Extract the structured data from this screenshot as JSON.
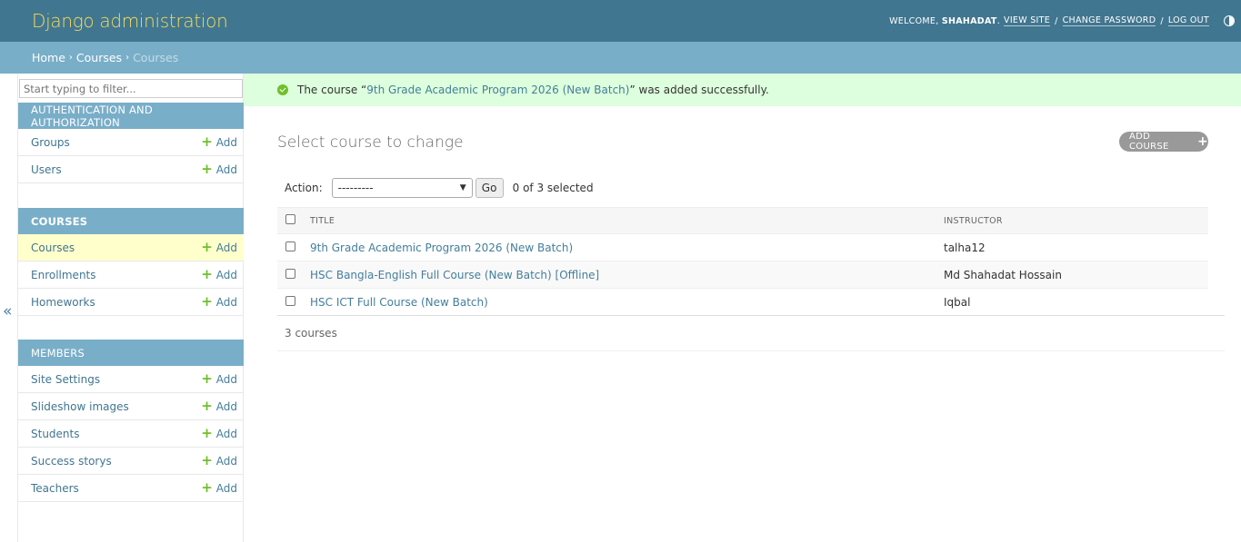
{
  "header": {
    "brand": "Django administration",
    "welcome_prefix": "WELCOME,",
    "username": "SHAHADAT",
    "welcome_suffix": ".",
    "view_site": "VIEW SITE",
    "change_password": "CHANGE PASSWORD",
    "log_out": "LOG OUT",
    "separator": "/",
    "theme_icon": "theme-toggle-icon"
  },
  "breadcrumbs": {
    "home": "Home",
    "app": "Courses",
    "current": "Courses",
    "separator": "›"
  },
  "sidebar": {
    "filter_placeholder": "Start typing to filter...",
    "collapse": "«",
    "add_label": "Add",
    "modules": [
      {
        "caption": "Authentication and Authorization",
        "models": [
          {
            "name": "Groups"
          },
          {
            "name": "Users"
          }
        ]
      },
      {
        "caption": "Courses",
        "models": [
          {
            "name": "Courses"
          },
          {
            "name": "Enrollments"
          },
          {
            "name": "Homeworks"
          }
        ]
      },
      {
        "caption": "Members",
        "models": [
          {
            "name": "Site Settings"
          },
          {
            "name": "Slideshow images"
          },
          {
            "name": "Students"
          },
          {
            "name": "Success storys"
          },
          {
            "name": "Teachers"
          }
        ]
      }
    ]
  },
  "message": {
    "prefix": "The course “",
    "object": "9th Grade Academic Program 2026 (New Batch)",
    "suffix": "” was added successfully."
  },
  "content": {
    "title": "Select course to change",
    "add_button": "ADD COURSE",
    "add_button_icon": "+",
    "action_label": "Action:",
    "action_selected": "---------",
    "go_label": "Go",
    "counter": "0 of 3 selected",
    "columns": [
      "TITLE",
      "INSTRUCTOR"
    ],
    "rows": [
      {
        "title": "9th Grade Academic Program 2026 (New Batch)",
        "instructor": "talha12"
      },
      {
        "title": "HSC Bangla-English Full Course (New Batch) [Offline]",
        "instructor": "Md Shahadat Hossain"
      },
      {
        "title": "HSC ICT Full Course (New Batch)",
        "instructor": "Iqbal"
      }
    ],
    "paginator": "3 courses"
  },
  "colors": {
    "header_bg": "#417690",
    "brand": "#f5dd5d",
    "breadcrumb_bg": "#79aec8",
    "module_caption_bg": "#79aec8",
    "link": "#447e9b",
    "add_plus": "#70bf2b",
    "success_bg": "#ddffdd",
    "current_row": "#ffffcc"
  }
}
